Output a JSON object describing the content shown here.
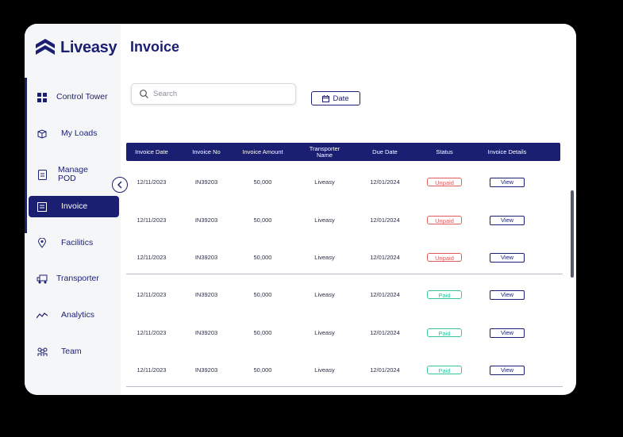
{
  "brand": {
    "name": "Liveasy",
    "color": "#1a1f71"
  },
  "page": {
    "title": "Invoice"
  },
  "sidebar": {
    "items": [
      {
        "label": "Control Tower",
        "icon": "dashboard-icon"
      },
      {
        "label": "My Loads",
        "icon": "box-icon"
      },
      {
        "label": "Manage POD",
        "icon": "document-icon"
      },
      {
        "label": "Invoice",
        "icon": "invoice-icon",
        "active": true
      },
      {
        "label": "Facilitics",
        "icon": "location-pin-icon"
      },
      {
        "label": "Transporter",
        "icon": "truck-icon"
      },
      {
        "label": "Analytics",
        "icon": "chart-line-icon"
      },
      {
        "label": "Team",
        "icon": "team-icon"
      }
    ]
  },
  "search": {
    "placeholder": "Search"
  },
  "filters": {
    "date_label": "Date"
  },
  "table": {
    "columns": [
      "Invoice Date",
      "Invoice No",
      "Invoice Amount",
      "Transporter Name",
      "Due Date",
      "Status",
      "Invoice Details"
    ],
    "rows": [
      {
        "date": "12/11/2023",
        "no": "IN39203",
        "amount": "50,000",
        "transporter": "Liveasy",
        "due": "12/01/2024",
        "status": "Unpaid",
        "action": "View"
      },
      {
        "date": "12/11/2023",
        "no": "IN39203",
        "amount": "50,000",
        "transporter": "Liveasy",
        "due": "12/01/2024",
        "status": "Unpaid",
        "action": "View"
      },
      {
        "date": "12/11/2023",
        "no": "IN39203",
        "amount": "50,000",
        "transporter": "Liveasy",
        "due": "12/01/2024",
        "status": "Unpaid",
        "action": "View"
      },
      {
        "date": "12/11/2023",
        "no": "IN39203",
        "amount": "50,000",
        "transporter": "Liveasy",
        "due": "12/01/2024",
        "status": "Paid",
        "action": "View"
      },
      {
        "date": "12/11/2023",
        "no": "IN39203",
        "amount": "50,000",
        "transporter": "Liveasy",
        "due": "12/01/2024",
        "status": "Paid",
        "action": "View"
      },
      {
        "date": "12/11/2023",
        "no": "IN39203",
        "amount": "50,000",
        "transporter": "Liveasy",
        "due": "12/01/2024",
        "status": "Paid",
        "action": "View"
      }
    ]
  },
  "status_colors": {
    "Unpaid": "#e05a5a",
    "Paid": "#35c6a0"
  }
}
